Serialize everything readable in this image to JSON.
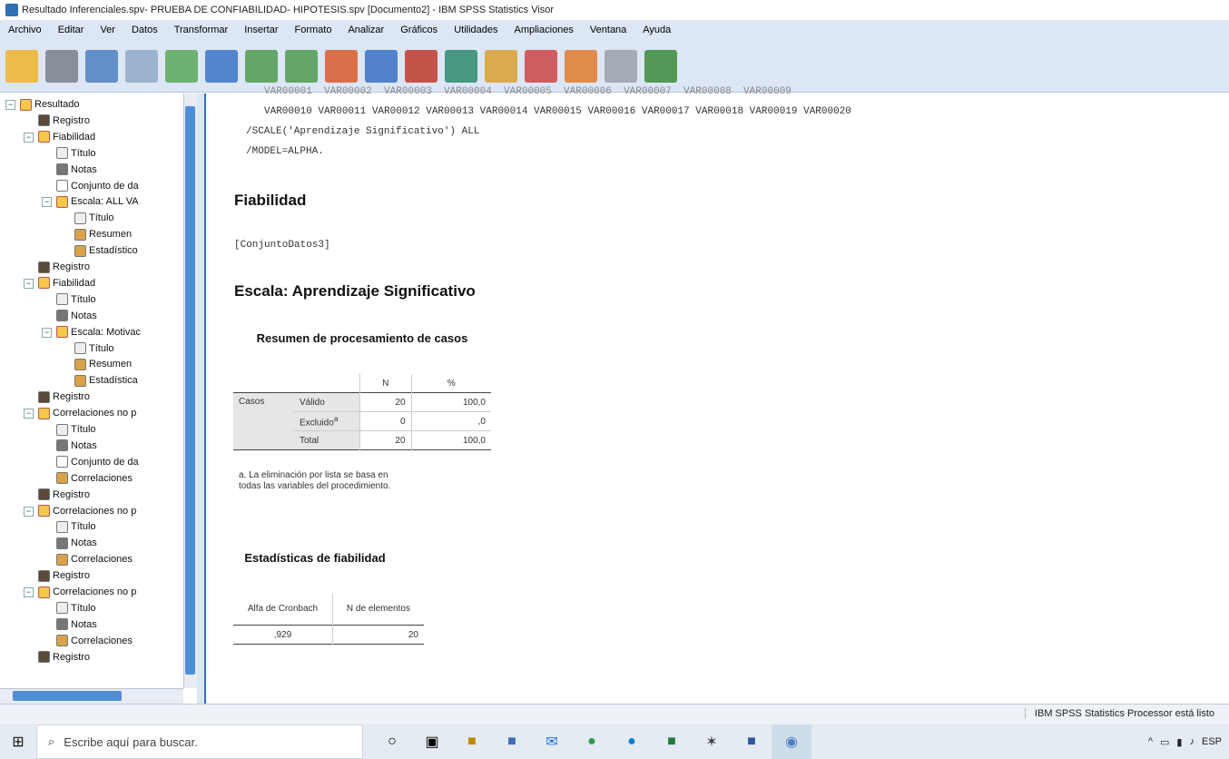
{
  "window": {
    "title": "Resultado Inferenciales.spv- PRUEBA DE CONFIABILIDAD- HIPOTESIS.spv [Documento2] - IBM SPSS Statistics Visor"
  },
  "menu": [
    "Archivo",
    "Editar",
    "Ver",
    "Datos",
    "Transformar",
    "Insertar",
    "Formato",
    "Analizar",
    "Gráficos",
    "Utilidades",
    "Ampliaciones",
    "Ventana",
    "Ayuda"
  ],
  "toolbar_icons": [
    "open-folder-icon",
    "save-icon",
    "print-icon",
    "print-preview-icon",
    "export-icon",
    "goto-data-icon",
    "undo-icon",
    "redo-icon",
    "goto-case-icon",
    "goto-variable-icon",
    "insert-output-icon",
    "variables-icon",
    "designated-window-icon",
    "promote-icon",
    "demote-icon",
    "show-icon",
    "hide-icon"
  ],
  "tree": [
    {
      "label": "Resultado",
      "level": 0,
      "icon": "proc"
    },
    {
      "label": "Registro",
      "level": 1,
      "icon": "log"
    },
    {
      "label": "Fiabilidad",
      "level": 1,
      "icon": "proc"
    },
    {
      "label": "Título",
      "level": 2,
      "icon": "title"
    },
    {
      "label": "Notas",
      "level": 2,
      "icon": "notes"
    },
    {
      "label": "Conjunto de da",
      "level": 2,
      "icon": "data"
    },
    {
      "label": "Escala: ALL VA",
      "level": 2,
      "icon": "proc"
    },
    {
      "label": "Título",
      "level": 3,
      "icon": "title"
    },
    {
      "label": "Resumen",
      "level": 3,
      "icon": "table"
    },
    {
      "label": "Estadístico",
      "level": 3,
      "icon": "table"
    },
    {
      "label": "Registro",
      "level": 1,
      "icon": "log"
    },
    {
      "label": "Fiabilidad",
      "level": 1,
      "icon": "proc"
    },
    {
      "label": "Título",
      "level": 2,
      "icon": "title"
    },
    {
      "label": "Notas",
      "level": 2,
      "icon": "notes"
    },
    {
      "label": "Escala: Motivac",
      "level": 2,
      "icon": "proc"
    },
    {
      "label": "Título",
      "level": 3,
      "icon": "title"
    },
    {
      "label": "Resumen",
      "level": 3,
      "icon": "table"
    },
    {
      "label": "Estadística",
      "level": 3,
      "icon": "table"
    },
    {
      "label": "Registro",
      "level": 1,
      "icon": "log"
    },
    {
      "label": "Correlaciones no p",
      "level": 1,
      "icon": "proc"
    },
    {
      "label": "Título",
      "level": 2,
      "icon": "title"
    },
    {
      "label": "Notas",
      "level": 2,
      "icon": "notes"
    },
    {
      "label": "Conjunto de da",
      "level": 2,
      "icon": "data"
    },
    {
      "label": "Correlaciones",
      "level": 2,
      "icon": "table"
    },
    {
      "label": "Registro",
      "level": 1,
      "icon": "log"
    },
    {
      "label": "Correlaciones no p",
      "level": 1,
      "icon": "proc"
    },
    {
      "label": "Título",
      "level": 2,
      "icon": "title"
    },
    {
      "label": "Notas",
      "level": 2,
      "icon": "notes"
    },
    {
      "label": "Correlaciones",
      "level": 2,
      "icon": "table"
    },
    {
      "label": "Registro",
      "level": 1,
      "icon": "log"
    },
    {
      "label": "Correlaciones no p",
      "level": 1,
      "icon": "proc"
    },
    {
      "label": "Título",
      "level": 2,
      "icon": "title"
    },
    {
      "label": "Notas",
      "level": 2,
      "icon": "notes"
    },
    {
      "label": "Correlaciones",
      "level": 2,
      "icon": "table"
    },
    {
      "label": "Registro",
      "level": 1,
      "icon": "log"
    }
  ],
  "output": {
    "syntax_partial": "VAR00001  VAR00002  VAR00003  VAR00004  VAR00005  VAR00006  VAR00007  VAR00008  VAR00009",
    "syntax_line1": "VAR00010 VAR00011 VAR00012 VAR00013 VAR00014 VAR00015 VAR00016 VAR00017 VAR00018 VAR00019 VAR00020",
    "syntax_line2": "/SCALE('Aprendizaje Significativo') ALL",
    "syntax_line3": "/MODEL=ALPHA.",
    "heading1": "Fiabilidad",
    "dataset": "[ConjuntoDatos3]",
    "heading2": "Escala: Aprendizaje Significativo",
    "table1": {
      "title": "Resumen de procesamiento de casos",
      "col_n": "N",
      "col_pct": "%",
      "group": "Casos",
      "rows": [
        {
          "label": "Válido",
          "n": "20",
          "pct": "100,0"
        },
        {
          "label": "Excluido",
          "sup": "a",
          "n": "0",
          "pct": ",0"
        },
        {
          "label": "Total",
          "n": "20",
          "pct": "100,0"
        }
      ],
      "footnote": "a. La eliminación por lista se basa en todas las variables del procedimiento."
    },
    "table2": {
      "title": "Estadísticas de fiabilidad",
      "col1": "Alfa de Cronbach",
      "col2": "N de elementos",
      "val1": ",929",
      "val2": "20"
    }
  },
  "status": "IBM SPSS Statistics Processor está listo",
  "taskbar": {
    "search_placeholder": "Escribe aquí para buscar.",
    "tray_lang": "ESP"
  }
}
